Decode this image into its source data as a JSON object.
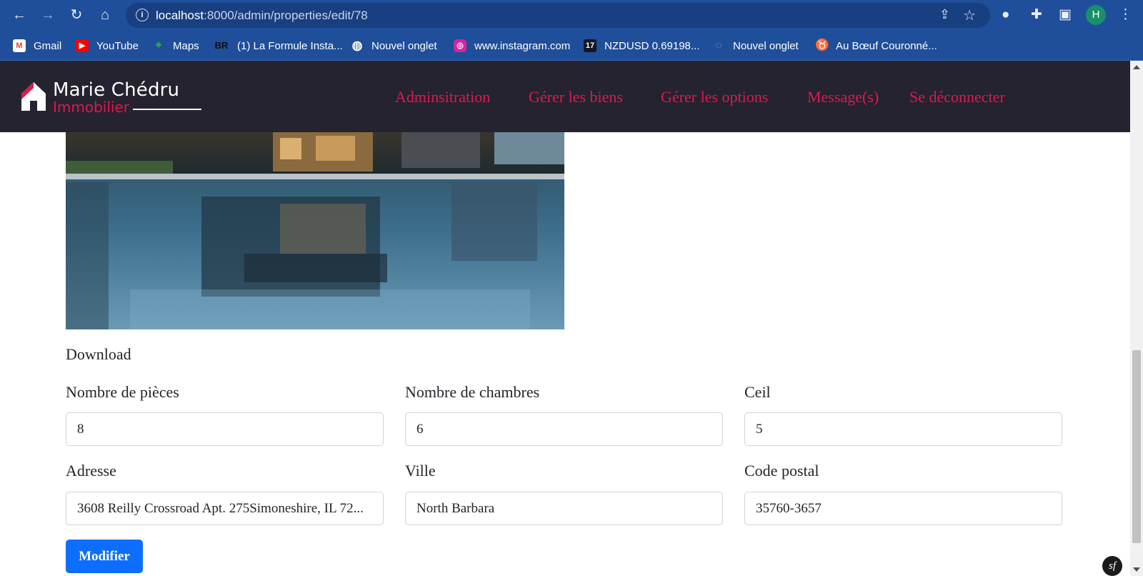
{
  "browser": {
    "url_host": "localhost",
    "url_rest": ":8000/admin/properties/edit/78",
    "profile_initial": "H",
    "bookmarks": [
      {
        "label": "Gmail",
        "icon": "M"
      },
      {
        "label": "YouTube",
        "icon": "▶"
      },
      {
        "label": "Maps",
        "icon": "⌖"
      },
      {
        "label": "(1) La Formule Insta...",
        "icon": "BR"
      },
      {
        "label": "Nouvel onglet",
        "icon": "◍"
      },
      {
        "label": "www.instagram.com",
        "icon": "◎"
      },
      {
        "label": "NZDUSD 0.69198...",
        "icon": "17"
      },
      {
        "label": "Nouvel onglet",
        "icon": "◌"
      },
      {
        "label": "Au Bœuf Couronné...",
        "icon": "♉"
      }
    ]
  },
  "site": {
    "brand": "Marie Chédru",
    "brand_sub": "Immobilier",
    "menu": [
      "Adminsitration",
      "Gérer les biens",
      "Gérer les options",
      "Message(s)",
      "Se déconnecter"
    ],
    "accent_color": "#e0194d"
  },
  "form": {
    "download_label": "Download",
    "fields": [
      {
        "label": "Nombre de pièces",
        "value": "8"
      },
      {
        "label": "Nombre de chambres",
        "value": "6"
      },
      {
        "label": "Ceil",
        "value": "5"
      },
      {
        "label": "Adresse",
        "value": "3608 Reilly Crossroad Apt. 275Simoneshire, IL 72..."
      },
      {
        "label": "Ville",
        "value": "North Barbara"
      },
      {
        "label": "Code postal",
        "value": "35760-3657"
      }
    ],
    "submit_label": "Modifier"
  },
  "debug_badge": "sf"
}
